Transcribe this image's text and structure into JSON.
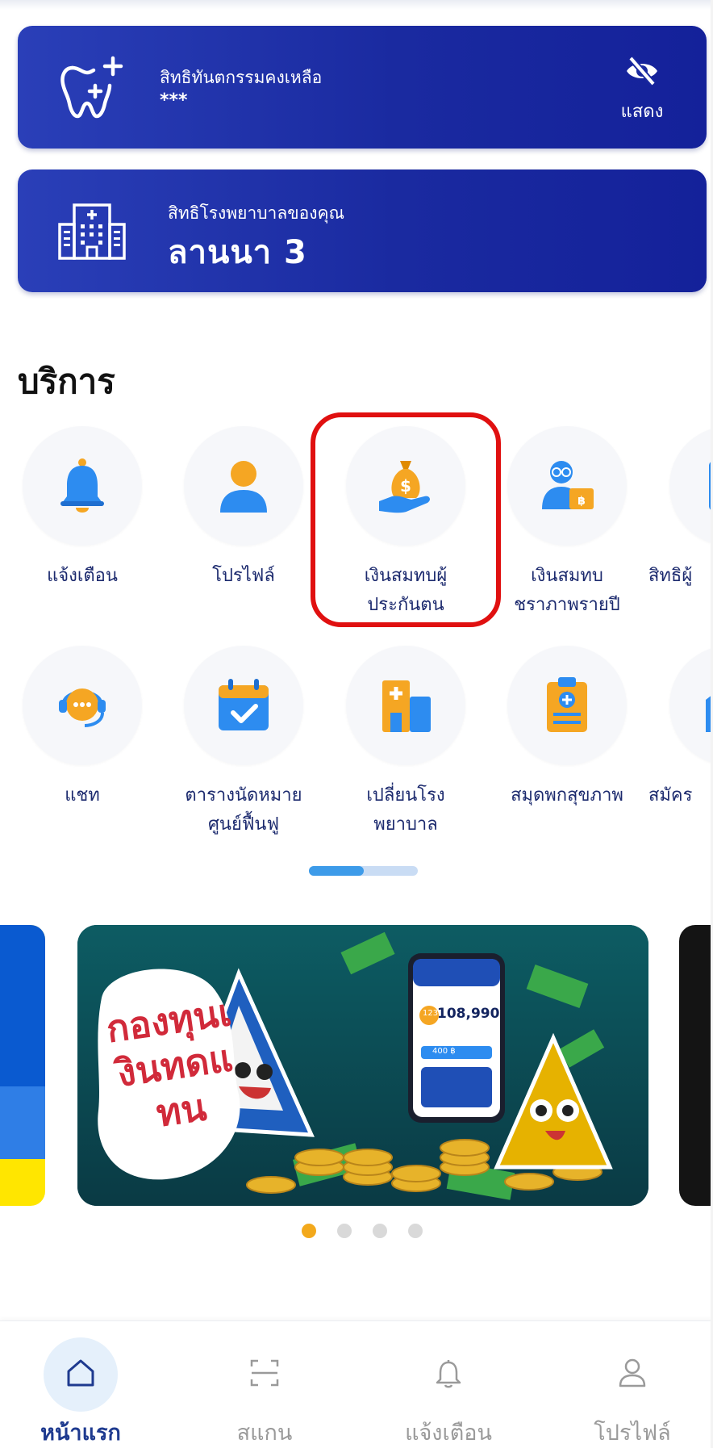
{
  "cards": {
    "dental": {
      "label": "สิทธิทันตกรรมคงเหลือ",
      "value": "***",
      "toggle_label": "แสดง"
    },
    "hospital": {
      "label": "สิทธิโรงพยาบาลของคุณ",
      "value": "ลานนา 3"
    }
  },
  "services": {
    "title": "บริการ",
    "row1": [
      {
        "label": "แจ้งเตือน",
        "icon": "bell-icon"
      },
      {
        "label": "โปรไฟล์",
        "icon": "person-icon"
      },
      {
        "label": "เงินสมทบผู้ประกันตน",
        "icon": "money-bag-hand-icon"
      },
      {
        "label": "เงินสมทบชราภาพรายปี",
        "icon": "elder-pension-icon"
      },
      {
        "label": "สิทธิผู้",
        "icon": "document-icon"
      }
    ],
    "row2": [
      {
        "label": "แชท",
        "icon": "chat-headset-icon"
      },
      {
        "label": "ตารางนัดหมายศูนย์ฟื้นฟู",
        "icon": "calendar-check-icon"
      },
      {
        "label": "เปลี่ยนโรงพยาบาล",
        "icon": "hospital-building-icon"
      },
      {
        "label": "สมุดพกสุขภาพ",
        "icon": "health-clipboard-icon"
      },
      {
        "label": "สมัคร",
        "icon": "building-icon"
      }
    ],
    "scroll_progress": 0.5
  },
  "carousel": {
    "banner_text": "กองทุนเงินทดแทน",
    "phone_amount": "108,990",
    "phone_badge": "123",
    "phone_small": "400 ฿",
    "page_count": 4,
    "active_page": 1
  },
  "bottom_nav": [
    {
      "label": "หน้าแรก",
      "icon": "home-icon",
      "active": true
    },
    {
      "label": "สแกน",
      "icon": "scan-icon",
      "active": false
    },
    {
      "label": "แจ้งเตือน",
      "icon": "bell-outline-icon",
      "active": false
    },
    {
      "label": "โปรไฟล์",
      "icon": "profile-outline-icon",
      "active": false
    }
  ],
  "colors": {
    "card_blue": "#1a2aa0",
    "highlight_red": "#e01010",
    "accent_orange": "#f3a91c",
    "nav_active": "#1e3a8f"
  }
}
